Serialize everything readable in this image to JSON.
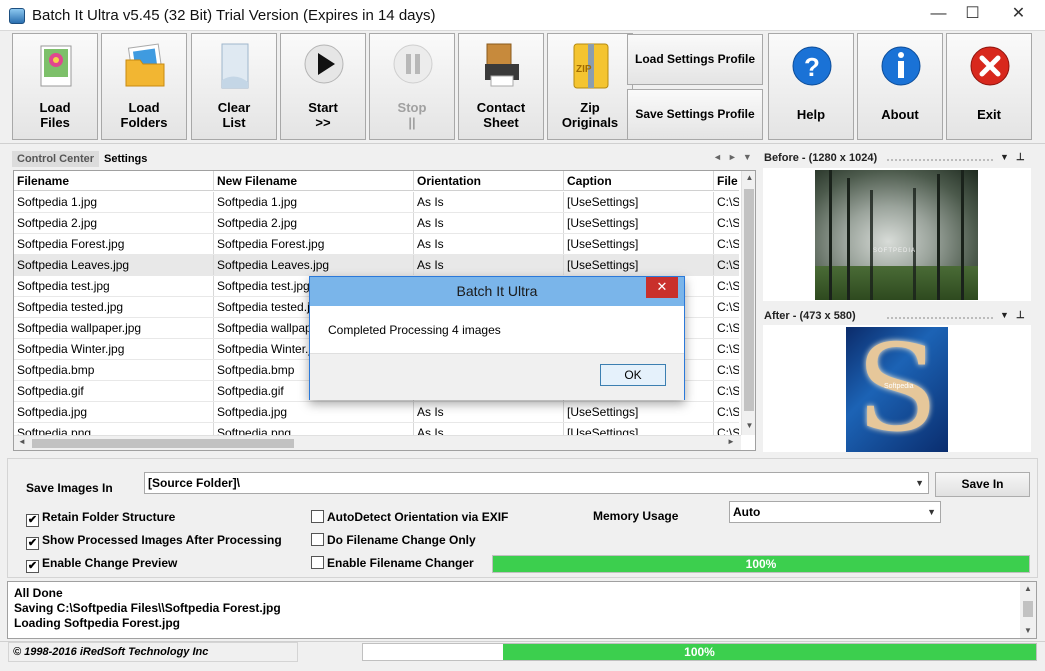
{
  "window": {
    "title": "Batch It Ultra v5.45 (32 Bit) Trial Version (Expires in 14 days)",
    "min_glyph": "—",
    "max_glyph": "☐",
    "close_glyph": "✕"
  },
  "toolbar": {
    "load_files": [
      "Load",
      "Files"
    ],
    "load_folders": [
      "Load",
      "Folders"
    ],
    "clear_list": [
      "Clear",
      "List"
    ],
    "start": [
      "Start",
      ">>"
    ],
    "stop": [
      "Stop",
      "||"
    ],
    "contact_sheet": [
      "Contact",
      "Sheet"
    ],
    "zip_originals": [
      "Zip",
      "Originals"
    ],
    "load_settings_profile": "Load Settings Profile",
    "save_settings_profile": "Save Settings Profile",
    "help": "Help",
    "about": "About",
    "exit": "Exit",
    "zip_icon_text": "ZIP"
  },
  "tabs": {
    "control_center": "Control Center",
    "settings": "Settings",
    "arrows": "◄►▼"
  },
  "grid": {
    "columns": [
      "Filename",
      "New Filename",
      "Orientation",
      "Caption",
      "File"
    ],
    "rows": [
      [
        "Softpedia 1.jpg",
        "Softpedia 1.jpg",
        "As Is",
        "[UseSettings]",
        "C:\\S"
      ],
      [
        "Softpedia 2.jpg",
        "Softpedia 2.jpg",
        "As Is",
        "[UseSettings]",
        "C:\\S"
      ],
      [
        "Softpedia Forest.jpg",
        "Softpedia Forest.jpg",
        "As Is",
        "[UseSettings]",
        "C:\\S"
      ],
      [
        "Softpedia Leaves.jpg",
        "Softpedia Leaves.jpg",
        "As Is",
        "[UseSettings]",
        "C:\\S"
      ],
      [
        "Softpedia test.jpg",
        "Softpedia test.jpg",
        "",
        "",
        "C:\\S"
      ],
      [
        "Softpedia tested.jpg",
        "Softpedia tested.jpg",
        "",
        "",
        "C:\\S"
      ],
      [
        "Softpedia wallpaper.jpg",
        "Softpedia wallpaper.jpg",
        "",
        "",
        "C:\\S"
      ],
      [
        "Softpedia Winter.jpg",
        "Softpedia Winter.jpg",
        "",
        "",
        "C:\\S"
      ],
      [
        "Softpedia.bmp",
        "Softpedia.bmp",
        "",
        "",
        "C:\\S"
      ],
      [
        "Softpedia.gif",
        "Softpedia.gif",
        "",
        "",
        "C:\\S"
      ],
      [
        "Softpedia.jpg",
        "Softpedia.jpg",
        "As Is",
        "[UseSettings]",
        "C:\\S"
      ],
      [
        "Softpedia.png",
        "Softpedia.png",
        "As Is",
        "[UseSettings]",
        "C:\\S"
      ]
    ],
    "selected_row": 3
  },
  "preview": {
    "before": "Before - (1280 x 1024)",
    "after": "After - (473 x 580)",
    "before_watermark": "SOFTPEDIA",
    "after_watermark": "Softpedia"
  },
  "dialog": {
    "title": "Batch It Ultra",
    "message": "Completed Processing 4 images",
    "ok": "OK",
    "close_glyph": "✕"
  },
  "settings": {
    "save_images_in_label": "Save Images In",
    "save_images_in_value": "[Source Folder]\\",
    "save_in_button": "Save In",
    "retain_folder_structure": "Retain Folder Structure",
    "show_processed": "Show Processed Images After Processing",
    "enable_change_preview": "Enable Change Preview",
    "autodetect_orientation": "AutoDetect Orientation via EXIF",
    "do_filename_change_only": "Do Filename Change Only",
    "enable_filename_changer": "Enable Filename Changer",
    "memory_usage_label": "Memory Usage",
    "memory_usage_value": "Auto",
    "progress_text": "100%",
    "progress_value": 1.0,
    "check_glyph": "✔"
  },
  "checks": {
    "retain_folder_structure": true,
    "show_processed": true,
    "enable_change_preview": true,
    "autodetect_orientation": false,
    "do_filename_change_only": false,
    "enable_filename_changer": false
  },
  "log": {
    "lines": [
      "All Done",
      "Saving C:\\Softpedia Files\\\\Softpedia Forest.jpg",
      "Loading Softpedia Forest.jpg"
    ]
  },
  "status": {
    "copyright": "© 1998-2016 iRedSoft Technology Inc",
    "progress_text": "100%",
    "progress_value": 1.0
  },
  "colors": {
    "progress_green": "#3ccf4e",
    "dialog_title": "#7ab5ea",
    "dialog_border": "#2b79d9",
    "close_red": "#c9302c"
  }
}
